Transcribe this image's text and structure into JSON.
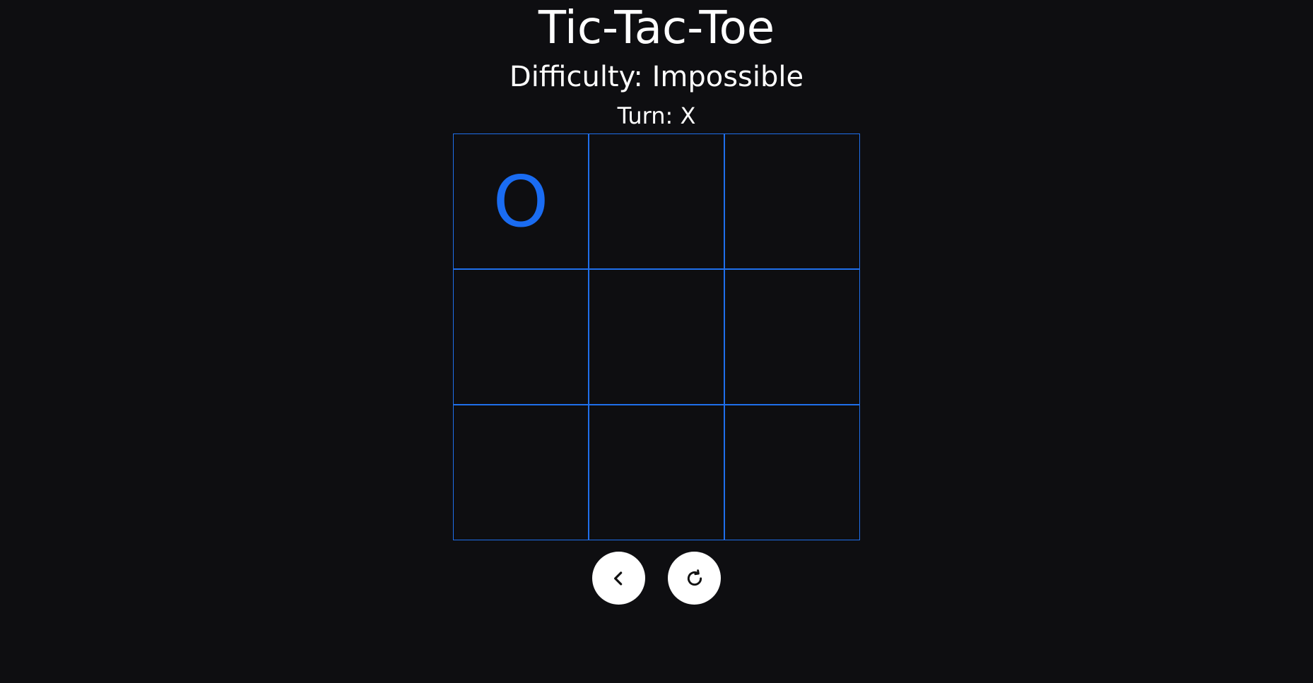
{
  "header": {
    "title": "Tic-Tac-Toe",
    "difficulty": "Difficulty: Impossible",
    "turn": "Turn: X"
  },
  "board": {
    "cells": [
      "O",
      "",
      "",
      "",
      "",
      "",
      "",
      "",
      ""
    ],
    "grid_color": "#1f6feb",
    "mark_color": "#1a6cf2"
  },
  "controls": {
    "back_icon": "chevron-left-icon",
    "restart_icon": "restart-icon"
  },
  "colors": {
    "background": "#0e0e11",
    "text": "#ffffff",
    "button_bg": "#ffffff"
  }
}
